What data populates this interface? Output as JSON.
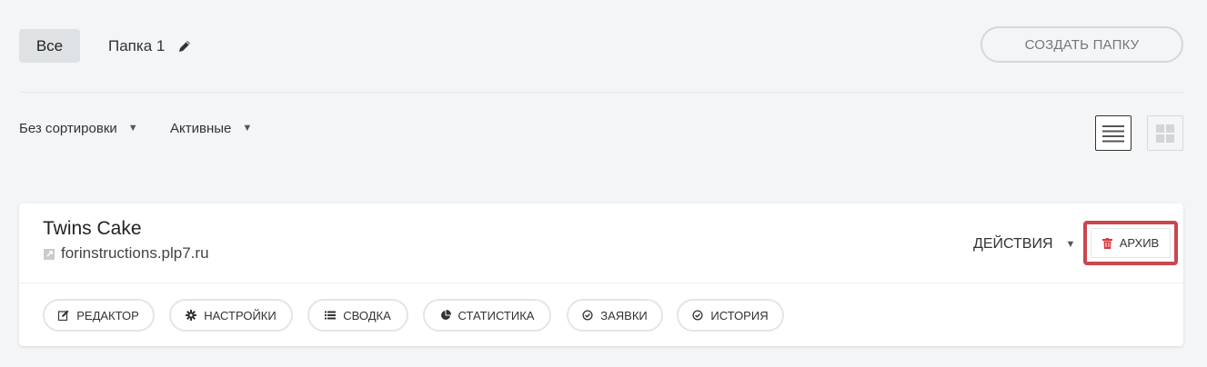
{
  "folders": {
    "all_label": "Все",
    "folder_label": "Папка 1",
    "create_label": "СОЗДАТЬ ПАПКУ"
  },
  "filters": {
    "sort_label": "Без сортировки",
    "status_label": "Активные",
    "arrow": "▼"
  },
  "view": {
    "active": "list-view-icon",
    "inactive": "grid-view-icon"
  },
  "site": {
    "title": "Twins Cake",
    "url": "forinstructions.plp7.ru",
    "actions_label": "ДЕЙСТВИЯ",
    "archive_label": "АРХИВ"
  },
  "tools": [
    {
      "label": "РЕДАКТОР",
      "icon": "edit-icon"
    },
    {
      "label": "НАСТРОЙКИ",
      "icon": "gear-icon"
    },
    {
      "label": "СВОДКА",
      "icon": "list-icon"
    },
    {
      "label": "СТАТИСТИКА",
      "icon": "pie-chart-icon"
    },
    {
      "label": "ЗАЯВКИ",
      "icon": "check-circle-icon"
    },
    {
      "label": "ИСТОРИЯ",
      "icon": "check-circle-icon"
    }
  ],
  "colors": {
    "highlight": "#c9474f",
    "trash": "#d9363e"
  }
}
